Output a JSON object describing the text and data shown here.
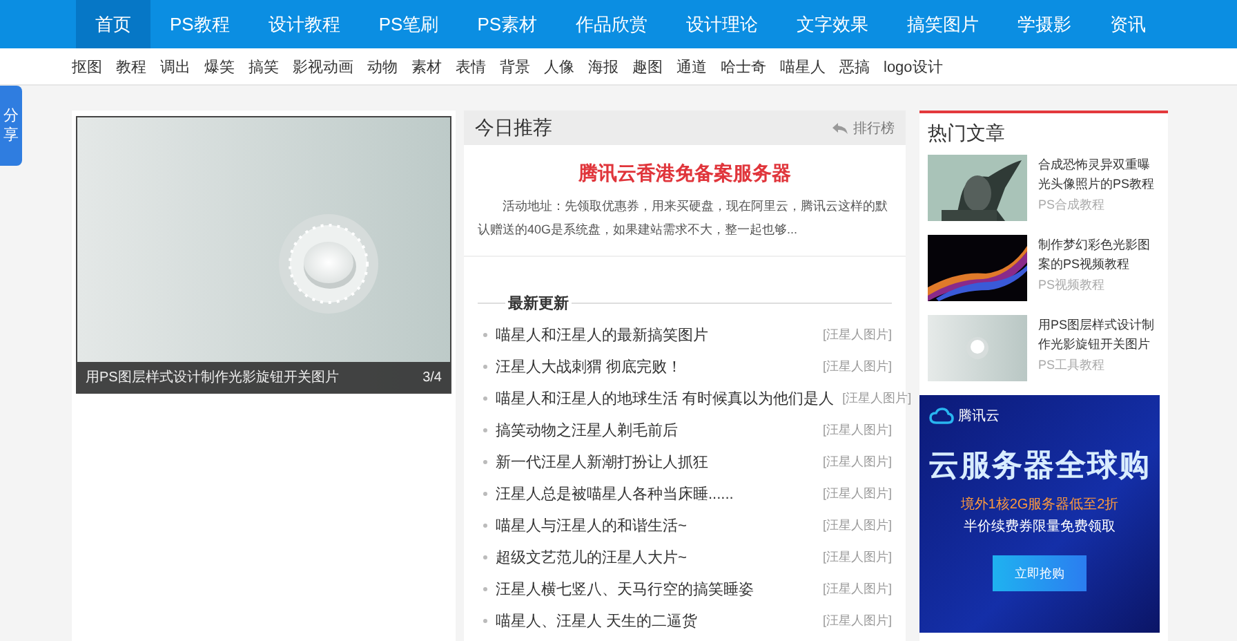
{
  "nav": [
    {
      "label": "首页",
      "selected": true
    },
    {
      "label": "PS教程",
      "selected": false
    },
    {
      "label": "设计教程",
      "selected": false
    },
    {
      "label": "PS笔刷",
      "selected": false
    },
    {
      "label": "PS素材",
      "selected": false
    },
    {
      "label": "作品欣赏",
      "selected": false
    },
    {
      "label": "设计理论",
      "selected": false
    },
    {
      "label": "文字效果",
      "selected": false
    },
    {
      "label": "搞笑图片",
      "selected": false
    },
    {
      "label": "学摄影",
      "selected": false
    },
    {
      "label": "资讯",
      "selected": false
    }
  ],
  "tags": [
    "抠图",
    "教程",
    "调出",
    "爆笑",
    "搞笑",
    "影视动画",
    "动物",
    "素材",
    "表情",
    "背景",
    "人像",
    "海报",
    "趣图",
    "通道",
    "哈士奇",
    "喵星人",
    "恶搞",
    "logo设计"
  ],
  "share_tab": "分享",
  "slideshow": {
    "caption": "用PS图层样式设计制作光影旋钮开关图片",
    "counter": "3/4"
  },
  "today": {
    "title": "今日推荐",
    "ranking_link": "排行榜",
    "headline": "腾讯云香港免备案服务器",
    "summary": "活动地址：先领取优惠券，用来买硬盘，现在阿里云，腾讯云这样的默认赠送的40G是系统盘，如果建站需求不大，整一起也够..."
  },
  "latest": {
    "title": "最新更新",
    "items": [
      {
        "title": "喵星人和汪星人的最新搞笑图片",
        "category": "[汪星人图片]"
      },
      {
        "title": "汪星人大战刺猬 彻底完败！",
        "category": "[汪星人图片]"
      },
      {
        "title": "喵星人和汪星人的地球生活 有时候真以为他们是人",
        "category": "[汪星人图片]"
      },
      {
        "title": "搞笑动物之汪星人剃毛前后",
        "category": "[汪星人图片]"
      },
      {
        "title": "新一代汪星人新潮打扮让人抓狂",
        "category": "[汪星人图片]"
      },
      {
        "title": "汪星人总是被喵星人各种当床睡......",
        "category": "[汪星人图片]"
      },
      {
        "title": "喵星人与汪星人的和谐生活~",
        "category": "[汪星人图片]"
      },
      {
        "title": "超级文艺范儿的汪星人大片~",
        "category": "[汪星人图片]"
      },
      {
        "title": "汪星人横七竖八、天马行空的搞笑睡姿",
        "category": "[汪星人图片]"
      },
      {
        "title": "喵星人、汪星人 天生的二逼货",
        "category": "[汪星人图片]"
      }
    ]
  },
  "hot": {
    "title": "热门文章",
    "items": [
      {
        "title": "合成恐怖灵异双重曝光头像照片的PS教程",
        "category": "PS合成教程",
        "kind": "portrait"
      },
      {
        "title": "制作梦幻彩色光影图案的PS视频教程",
        "category": "PS视频教程",
        "kind": "light"
      },
      {
        "title": "用PS图层样式设计制作光影旋钮开关图片",
        "category": "PS工具教程",
        "kind": "knob"
      }
    ]
  },
  "ad": {
    "brand": "腾讯云",
    "headline": "云服务器全球购",
    "offer": "境外1核2G服务器低至2折",
    "subline": "半价续费券限量免费领取",
    "button": "立即抢购"
  }
}
